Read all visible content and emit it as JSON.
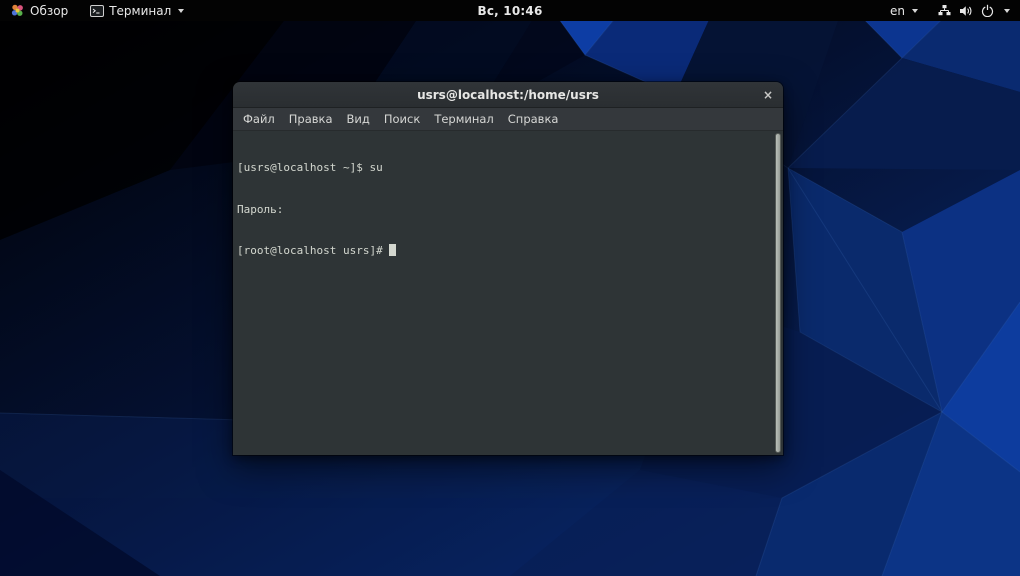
{
  "topbar": {
    "activities_label": "Обзор",
    "app_menu_label": "Терминал",
    "clock": "Вс, 10:46",
    "keyboard_layout": "en",
    "icons": [
      "distro-logo-icon",
      "terminal-app-icon",
      "network-wired-icon",
      "volume-icon",
      "power-icon",
      "chevron-down-icon"
    ]
  },
  "window": {
    "title": "usrs@localhost:/home/usrs",
    "close_glyph": "×",
    "menu_items": [
      "Файл",
      "Правка",
      "Вид",
      "Поиск",
      "Терминал",
      "Справка"
    ],
    "lines": [
      "[usrs@localhost ~]$ su",
      "Пароль: ",
      "[root@localhost usrs]# "
    ]
  },
  "colors": {
    "topbar_bg": "#030303",
    "titlebar_bg": "#2d3134",
    "menubar_bg": "#34383c",
    "terminal_bg": "#2e3436",
    "terminal_fg": "#d3d7cf",
    "wallpaper_dark": "#000104",
    "wallpaper_navy": "#071c4e",
    "wallpaper_bright": "#0d3da4",
    "scrollbar_thumb": "#a9afa9"
  }
}
